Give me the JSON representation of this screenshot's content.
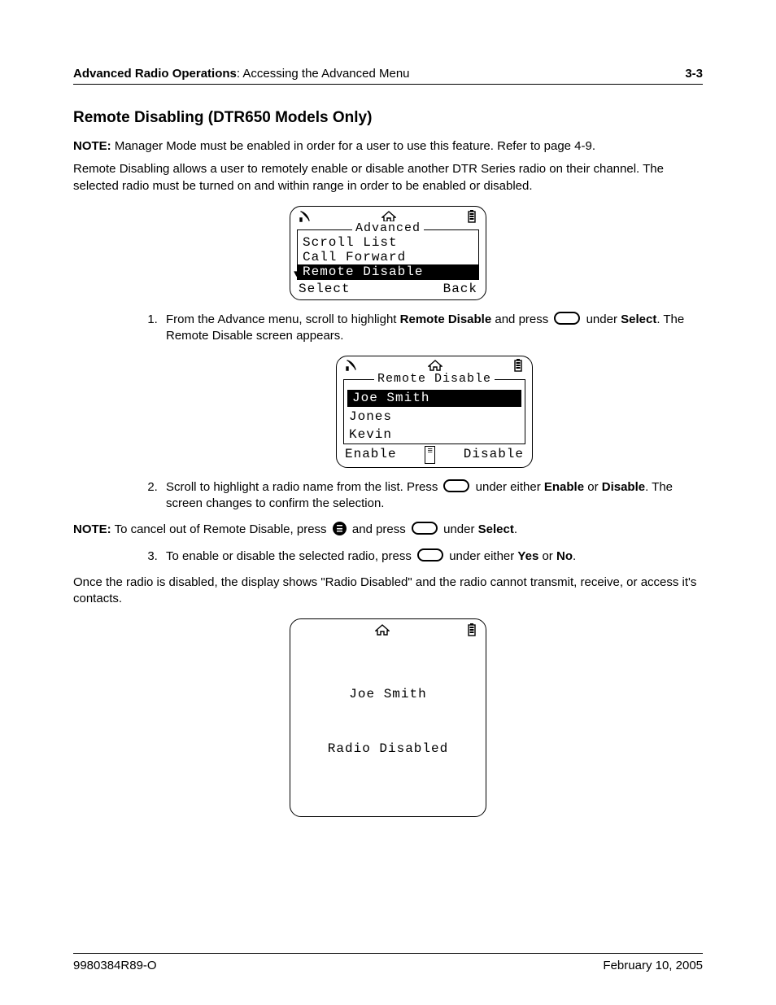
{
  "header": {
    "chapter": "Advanced Radio Operations",
    "section": "Accessing the Advanced Menu",
    "page": "3-3"
  },
  "title": "Remote Disabling (DTR650 Models Only)",
  "note1": {
    "label": "NOTE:",
    "text": "Manager Mode must be enabled in order for a user to use this feature. Refer to page 4-9."
  },
  "intro": "Remote Disabling allows a user to remotely enable or disable another DTR Series radio on their channel. The selected radio must be turned on and within range in order to be enabled or disabled.",
  "screen1": {
    "title": "Advanced",
    "items": [
      "Scroll List",
      "Call Forward",
      "Remote Disable"
    ],
    "selected": 2,
    "softLeft": "Select",
    "softRight": "Back"
  },
  "step1": {
    "a": "From the Advance menu, scroll to highlight ",
    "b": "Remote Disable",
    "c": " and press ",
    "d": " under ",
    "e": "Select",
    "f": ". The Remote Disable screen appears."
  },
  "screen2": {
    "title": "Remote Disable",
    "items": [
      "Joe Smith",
      "Jones",
      "Kevin"
    ],
    "selected": 0,
    "softLeft": "Enable",
    "softRight": "Disable"
  },
  "step2": {
    "a": "Scroll to highlight a radio name from the list. Press ",
    "b": " under either ",
    "c": "Enable",
    "d": " or ",
    "e": "Disable",
    "f": ". The screen changes to confirm the selection."
  },
  "note2": {
    "label": "NOTE:",
    "a": "To cancel out of Remote Disable, press ",
    "b": " and press ",
    "c": " under ",
    "d": "Select",
    "e": "."
  },
  "step3": {
    "a": "To enable or disable the selected radio, press ",
    "b": " under either ",
    "c": "Yes",
    "d": " or ",
    "e": "No",
    "f": "."
  },
  "outro": "Once the radio is disabled, the display shows \"Radio Disabled\" and the radio cannot transmit, receive, or access it's contacts.",
  "screen3": {
    "line1": "Joe Smith",
    "line2": "Radio Disabled"
  },
  "footer": {
    "left": "9980384R89-O",
    "right": "February 10, 2005"
  }
}
